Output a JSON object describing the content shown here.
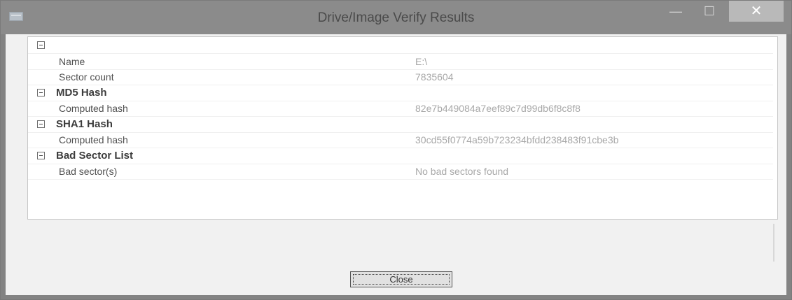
{
  "window": {
    "title": "Drive/Image Verify Results",
    "minimize": "—",
    "maximize": "☐",
    "close": "✕"
  },
  "tree": {
    "groups": [
      {
        "label": "",
        "rows": [
          {
            "name": "Name",
            "value": "E:\\"
          },
          {
            "name": "Sector count",
            "value": "7835604"
          }
        ]
      },
      {
        "label": "MD5 Hash",
        "rows": [
          {
            "name": "Computed hash",
            "value": "82e7b449084a7eef89c7d99db6f8c8f8"
          }
        ]
      },
      {
        "label": "SHA1 Hash",
        "rows": [
          {
            "name": "Computed hash",
            "value": "30cd55f0774a59b723234bfdd238483f91cbe3b"
          }
        ]
      },
      {
        "label": "Bad Sector List",
        "rows": [
          {
            "name": "Bad sector(s)",
            "value": "No bad sectors found"
          }
        ]
      }
    ]
  },
  "buttons": {
    "close_label": "Close"
  }
}
